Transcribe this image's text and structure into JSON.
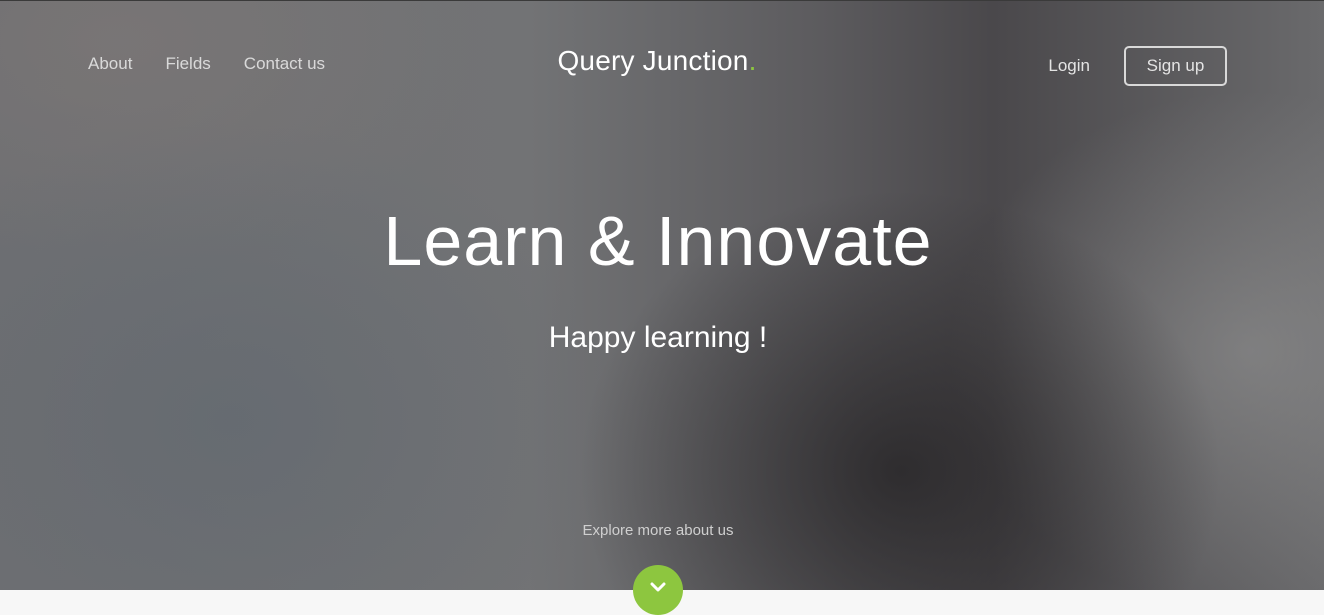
{
  "nav": {
    "left_links": [
      "About",
      "Fields",
      "Contact us"
    ],
    "brand_name": "Query Junction",
    "brand_dot": ".",
    "login_label": "Login",
    "signup_label": "Sign up"
  },
  "hero": {
    "headline": "Learn & Innovate",
    "subline": "Happy learning !",
    "explore_text": "Explore more about us",
    "scroll_icon": "chevron-down-icon"
  },
  "colors": {
    "accent": "#8dc63f",
    "text": "#ffffff"
  }
}
